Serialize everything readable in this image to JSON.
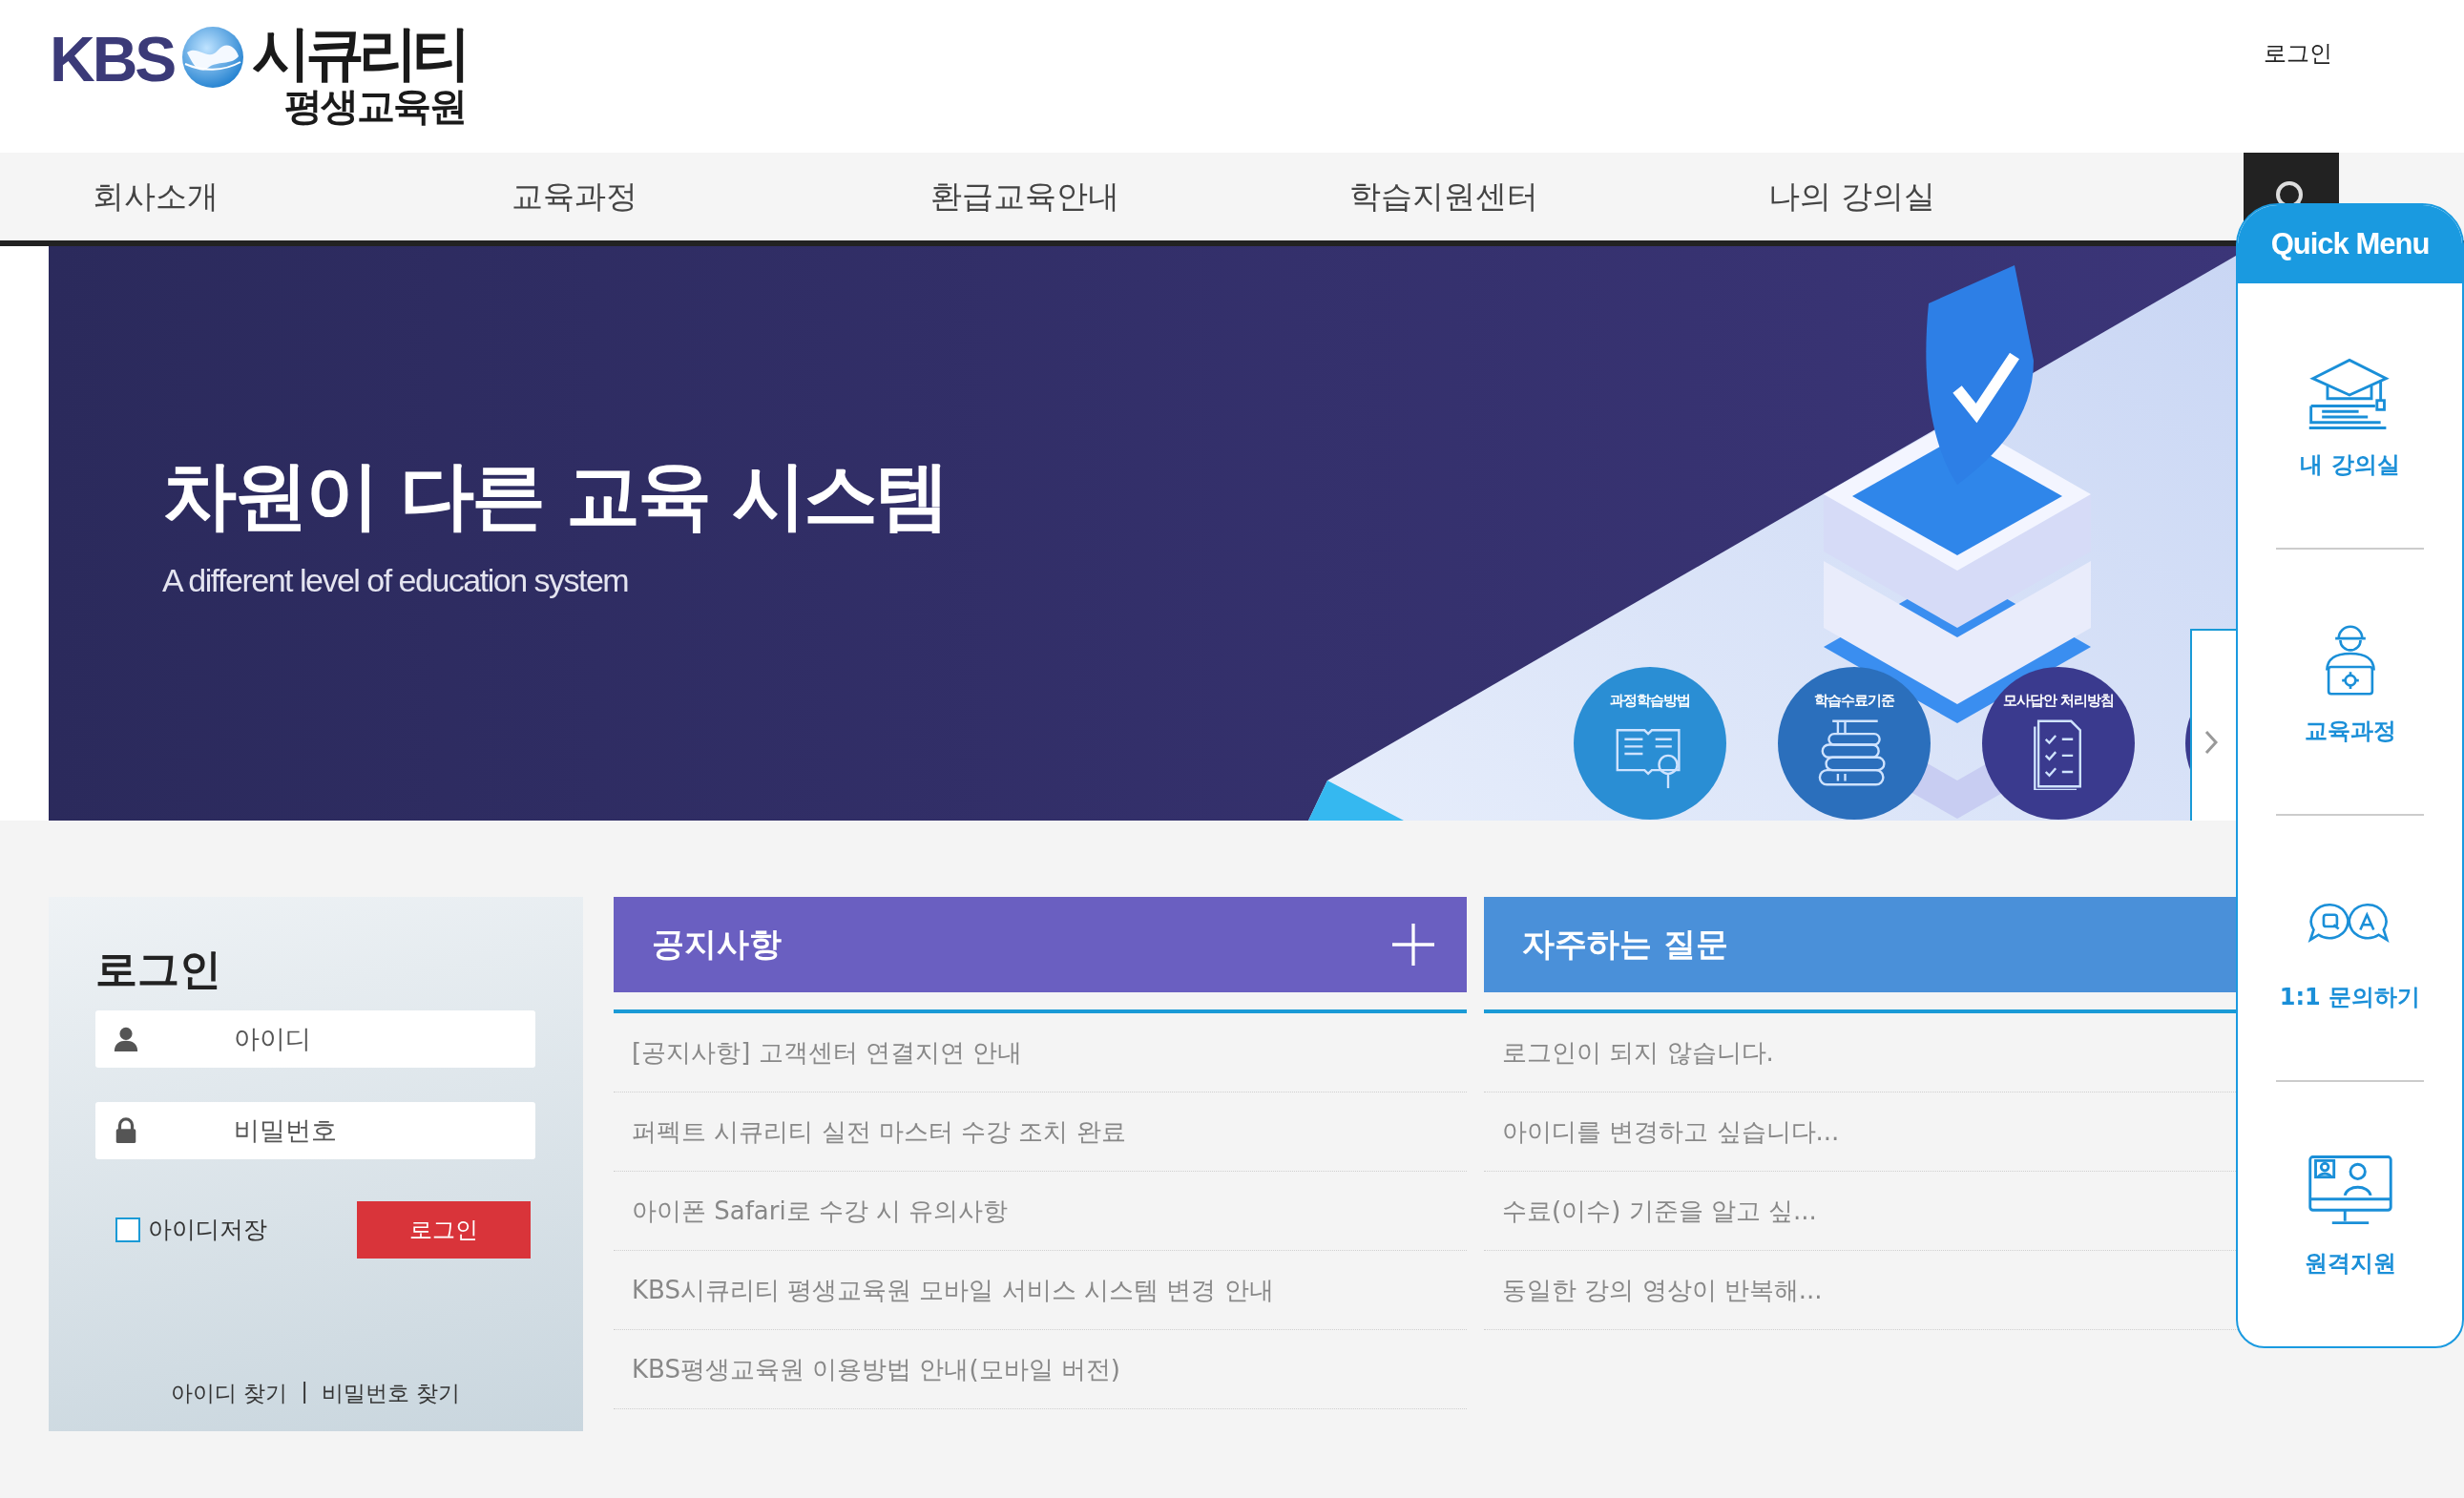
{
  "header": {
    "logo": {
      "brand": "KBS",
      "name": "시큐리티",
      "subtitle": "평생교육원"
    },
    "login_link": "로그인"
  },
  "nav": {
    "items": [
      "회사소개",
      "교육과정",
      "환급교육안내",
      "학습지원센터",
      "나의 강의실"
    ]
  },
  "banner": {
    "heading": "차원이 다른 교육 시스템",
    "subheading": "A different level of education system",
    "buttons": [
      {
        "label": "과정학습방법",
        "kind": "book"
      },
      {
        "label": "학습수료기준",
        "kind": "stack"
      },
      {
        "label": "모사답안 처리방침",
        "kind": "checklist"
      }
    ]
  },
  "login": {
    "title": "로그인",
    "id_placeholder": "아이디",
    "password_placeholder": "비밀번호",
    "remember": {
      "label": "아이디저장",
      "checked": false
    },
    "submit": "로그인",
    "links": [
      "아이디 찾기",
      "비밀번호 찾기"
    ],
    "link_separator": "|"
  },
  "notices": {
    "title": "공지사항",
    "items": [
      "[공지사항] 고객센터 연결지연 안내",
      "퍼펙트 시큐리티 실전 마스터 수강 조치 완료",
      "아이폰 Safari로 수강 시 유의사항",
      "KBS시큐리티 평생교육원 모바일 서비스 시스템 변경 안내",
      "KBS평생교육원 이용방법 안내(모바일 버전)"
    ]
  },
  "faq": {
    "title": "자주하는 질문",
    "items": [
      "로그인이 되지 않습니다.",
      "아이디를 변경하고 싶습니다...",
      "수료(이수) 기준을 알고 싶...",
      "동일한 강의 영상이 반복해..."
    ]
  },
  "quick_menu": {
    "title": "Quick Menu",
    "items": [
      {
        "label": "내 강의실",
        "kind": "cap"
      },
      {
        "label": "교육과정",
        "kind": "worker"
      },
      {
        "label": "1:1 문의하기",
        "kind": "qa"
      },
      {
        "label": "원격지원",
        "kind": "monitor"
      }
    ]
  }
}
